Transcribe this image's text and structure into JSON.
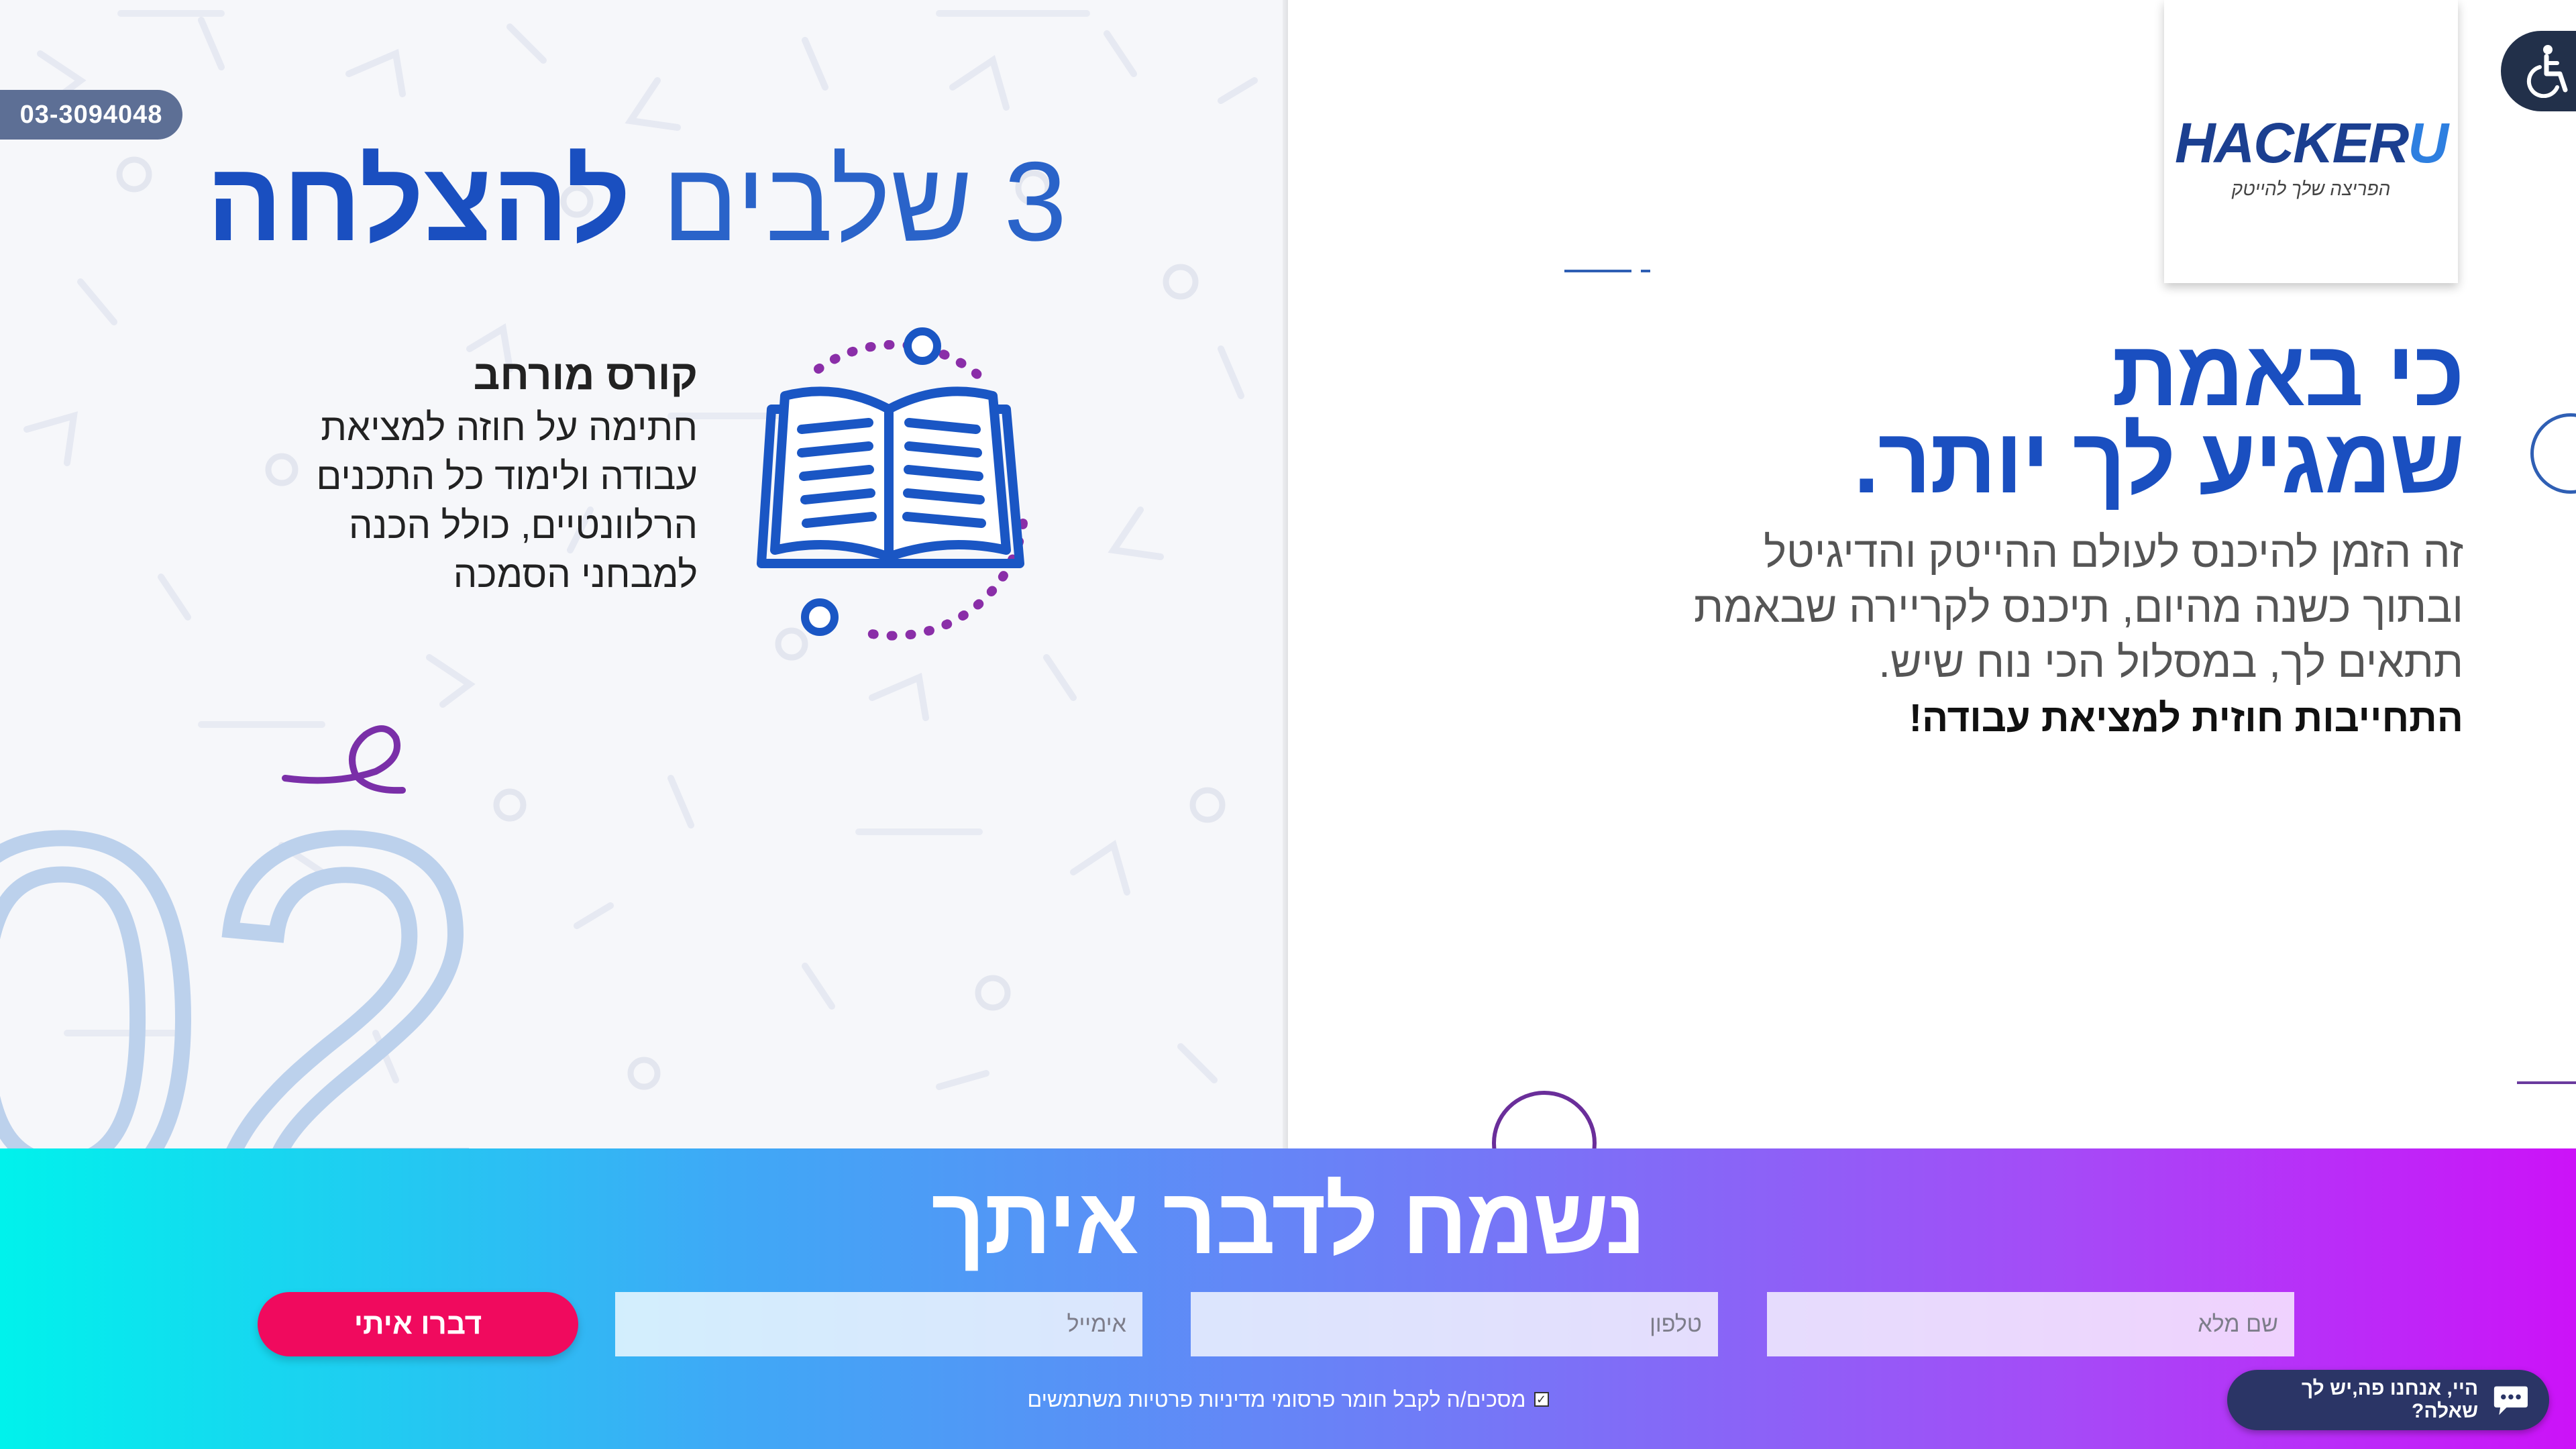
{
  "phone": "03-3094048",
  "steps": {
    "title_light": "3 שלבים",
    "title_strong": "להצלחה"
  },
  "course": {
    "heading": "קורס מורחב",
    "lines": [
      "חתימה על חוזה למציאת",
      "עבודה ולימוד כל התכנים",
      "הרלוונטיים, כולל הכנה",
      "למבחני הסמכה"
    ]
  },
  "step_number": "02",
  "logo": {
    "word_main": "HACKER",
    "word_end": "U",
    "tagline": "הפריצה שלך להייטק"
  },
  "hero": {
    "heading_line1": "כי באמת",
    "heading_line2": "שמגיע לך יותר.",
    "sub_lines": [
      "זה הזמן להיכנס לעולם ההייטק והדיגיטל",
      "ובתוך כשנה מהיום, תיכנס לקריירה שבאמת",
      "תתאים לך, במסלול הכי נוח שיש."
    ],
    "promise": "התחייבות חוזית למציאת עבודה!"
  },
  "contact": {
    "title": "נשמח לדבר איתך",
    "name_placeholder": "שם מלא",
    "phone_placeholder": "טלפון",
    "email_placeholder": "אימייל",
    "submit_label": "דברו איתי",
    "consent_label": "מסכים/ה לקבל חומר פרסומי מדיניות פרטיות משתמשים"
  },
  "chat": {
    "label": "היי, אנחנו פה,יש לך שאלה?"
  },
  "icons": {
    "accessibility": "accessibility-icon",
    "chat": "chat-bubble-icon",
    "book": "open-book-icon"
  },
  "colors": {
    "brand_blue": "#1a4fc0",
    "accent_purple": "#7a2fa8",
    "cta_pink": "#f00a5e",
    "gradient_start": "#00f2ec",
    "gradient_end": "#cc12f8"
  }
}
